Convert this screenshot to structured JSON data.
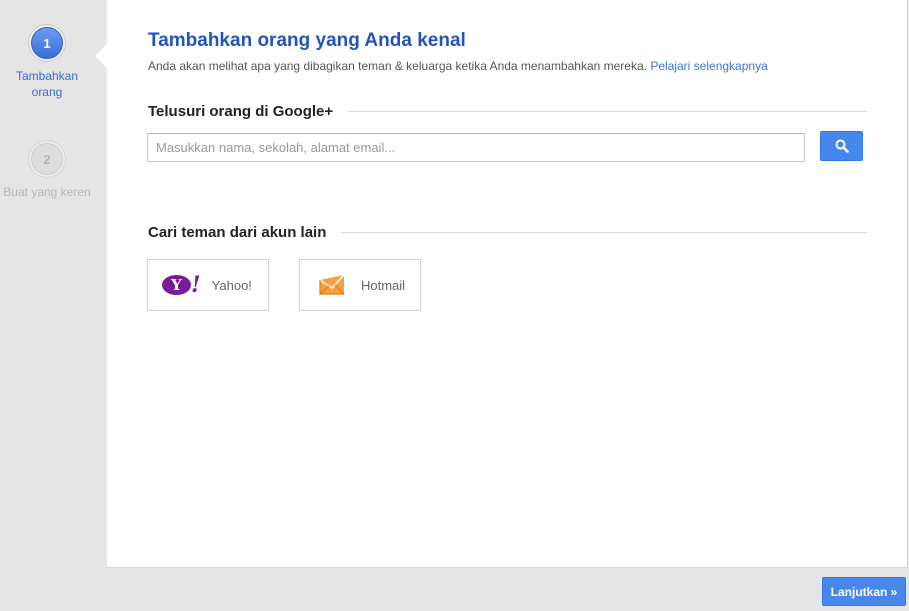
{
  "stepper": {
    "steps": [
      {
        "number": "1",
        "label": "Tambahkan orang",
        "state": "active"
      },
      {
        "number": "2",
        "label": "Buat yang keren",
        "state": "inactive"
      }
    ]
  },
  "main": {
    "title": "Tambahkan orang yang Anda kenal",
    "subtitle": "Anda akan melihat apa yang dibagikan teman & keluarga ketika Anda menambahkan mereka.",
    "learn_more_link": "Pelajari selengkapnya",
    "search_section": {
      "heading": "Telusuri orang di Google+",
      "input_value": "",
      "input_placeholder": "Masukkan nama, sekolah, alamat email...",
      "button_icon": "search-icon"
    },
    "accounts_section": {
      "heading": "Cari teman dari akun lain",
      "providers": [
        {
          "name": "Yahoo!",
          "logo_text": "Y",
          "icon": "yahoo-logo"
        },
        {
          "name": "Hotmail",
          "icon": "hotmail-envelope-icon"
        }
      ]
    }
  },
  "footer": {
    "next_button": "Lanjutkan »"
  },
  "colors": {
    "accent_blue": "#4787ed",
    "title_blue": "#2255b8",
    "link_blue": "#3a74d6",
    "yahoo_purple": "#7a1b9a",
    "hotmail_orange": "#f28a1f",
    "background": "#e5e5e5"
  }
}
